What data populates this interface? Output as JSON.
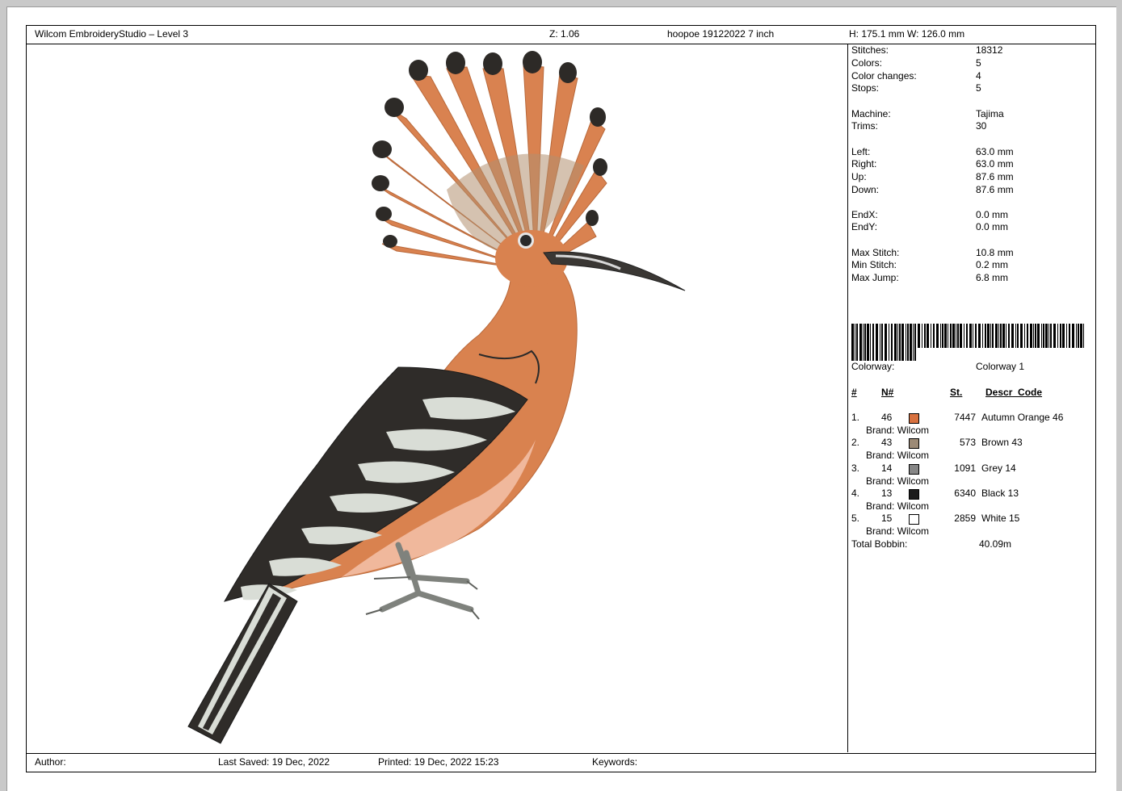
{
  "header": {
    "app": "Wilcom EmbroideryStudio – Level 3",
    "zoom": "Z: 1.06",
    "filename": "hoopoe 19122022 7 inch",
    "size": "H: 175.1 mm   W: 126.0 mm"
  },
  "stats": [
    {
      "label": "Stitches:",
      "value": "18312"
    },
    {
      "label": "Colors:",
      "value": "5"
    },
    {
      "label": "Color changes:",
      "value": "4"
    },
    {
      "label": "Stops:",
      "value": "5"
    },
    {
      "label": "Machine:",
      "value": "Tajima"
    },
    {
      "label": "Trims:",
      "value": "30"
    },
    {
      "label": "Left:",
      "value": "63.0 mm"
    },
    {
      "label": "Right:",
      "value": "63.0 mm"
    },
    {
      "label": "Up:",
      "value": "87.6 mm"
    },
    {
      "label": "Down:",
      "value": "87.6 mm"
    },
    {
      "label": "EndX:",
      "value": "0.0 mm"
    },
    {
      "label": "EndY:",
      "value": "0.0 mm"
    },
    {
      "label": "Max Stitch:",
      "value": "10.8 mm"
    },
    {
      "label": "Min Stitch:",
      "value": "0.2 mm"
    },
    {
      "label": "Max Jump:",
      "value": "6.8 mm"
    }
  ],
  "colorway": {
    "label": "Colorway:",
    "value": "Colorway 1"
  },
  "color_table": {
    "headers": {
      "index": "#",
      "number": "N#",
      "stitches": "St.",
      "description": "Descr_Code"
    },
    "rows": [
      {
        "index": "1.",
        "number": "46",
        "color": "#d8713f",
        "stitches": "7447",
        "description": "Autumn Orange 46",
        "brand": "Brand: Wilcom"
      },
      {
        "index": "2.",
        "number": "43",
        "color": "#9c8a76",
        "stitches": "573",
        "description": "Brown 43",
        "brand": "Brand: Wilcom"
      },
      {
        "index": "3.",
        "number": "14",
        "color": "#868686",
        "stitches": "1091",
        "description": "Grey 14",
        "brand": "Brand: Wilcom"
      },
      {
        "index": "4.",
        "number": "13",
        "color": "#1c1c1c",
        "stitches": "6340",
        "description": "Black 13",
        "brand": "Brand: Wilcom"
      },
      {
        "index": "5.",
        "number": "15",
        "color": "#ffffff",
        "stitches": "2859",
        "description": "White 15",
        "brand": "Brand: Wilcom"
      }
    ],
    "total_bobbin_label": "Total Bobbin:",
    "total_bobbin_value": "40.09m"
  },
  "footer": {
    "author": "Author:",
    "last_saved": "Last Saved: 19 Dec, 2022",
    "printed": "Printed: 19 Dec, 2022 15:23",
    "keywords": "Keywords:"
  }
}
